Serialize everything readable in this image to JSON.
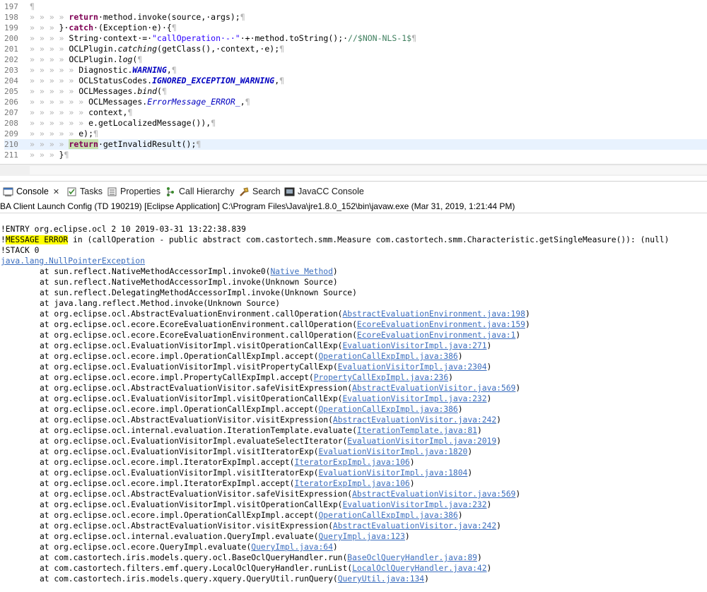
{
  "editor": {
    "lines": [
      {
        "n": "197",
        "segs": [
          {
            "t": "¶",
            "c": "ws"
          }
        ]
      },
      {
        "n": "198",
        "segs": [
          {
            "t": "» » » » ",
            "c": "ws"
          },
          {
            "t": "return",
            "c": "kw"
          },
          {
            "t": "·method.invoke(source,·args);",
            "c": ""
          },
          {
            "t": "¶",
            "c": "ws"
          }
        ]
      },
      {
        "n": "199",
        "segs": [
          {
            "t": "» » » ",
            "c": "ws"
          },
          {
            "t": "}·",
            "c": ""
          },
          {
            "t": "catch",
            "c": "kw"
          },
          {
            "t": "·(Exception·e)·{",
            "c": ""
          },
          {
            "t": "¶",
            "c": "ws"
          }
        ]
      },
      {
        "n": "200",
        "segs": [
          {
            "t": "» » » » ",
            "c": "ws"
          },
          {
            "t": "String·context·=·",
            "c": ""
          },
          {
            "t": "\"callOperation·-·\"",
            "c": "str"
          },
          {
            "t": "·+·method.toString();·",
            "c": ""
          },
          {
            "t": "//$NON-NLS-1$",
            "c": "cmt"
          },
          {
            "t": "¶",
            "c": "ws"
          }
        ]
      },
      {
        "n": "201",
        "segs": [
          {
            "t": "» » » » ",
            "c": "ws"
          },
          {
            "t": "OCLPlugin.",
            "c": ""
          },
          {
            "t": "catching",
            "c": "sm"
          },
          {
            "t": "(getClass(),·context,·e);",
            "c": ""
          },
          {
            "t": "¶",
            "c": "ws"
          }
        ]
      },
      {
        "n": "202",
        "segs": [
          {
            "t": "» » » » ",
            "c": "ws"
          },
          {
            "t": "OCLPlugin.",
            "c": ""
          },
          {
            "t": "log",
            "c": "sm"
          },
          {
            "t": "(",
            "c": ""
          },
          {
            "t": "¶",
            "c": "ws"
          }
        ]
      },
      {
        "n": "203",
        "segs": [
          {
            "t": "» » » » » ",
            "c": "ws"
          },
          {
            "t": "Diagnostic.",
            "c": ""
          },
          {
            "t": "WARNING",
            "c": "cst"
          },
          {
            "t": ",",
            "c": ""
          },
          {
            "t": "¶",
            "c": "ws"
          }
        ]
      },
      {
        "n": "204",
        "segs": [
          {
            "t": "» » » » » ",
            "c": "ws"
          },
          {
            "t": "OCLStatusCodes.",
            "c": ""
          },
          {
            "t": "IGNORED_EXCEPTION_WARNING",
            "c": "cst"
          },
          {
            "t": ",",
            "c": ""
          },
          {
            "t": "¶",
            "c": "ws"
          }
        ]
      },
      {
        "n": "205",
        "segs": [
          {
            "t": "» » » » » ",
            "c": "ws"
          },
          {
            "t": "OCLMessages.",
            "c": ""
          },
          {
            "t": "bind",
            "c": "sm"
          },
          {
            "t": "(",
            "c": ""
          },
          {
            "t": "¶",
            "c": "ws"
          }
        ]
      },
      {
        "n": "206",
        "segs": [
          {
            "t": "» » » » » » ",
            "c": "ws"
          },
          {
            "t": "OCLMessages.",
            "c": ""
          },
          {
            "t": "ErrorMessage_ERROR_",
            "c": "itf"
          },
          {
            "t": ",",
            "c": ""
          },
          {
            "t": "¶",
            "c": "ws"
          }
        ]
      },
      {
        "n": "207",
        "segs": [
          {
            "t": "» » » » » » ",
            "c": "ws"
          },
          {
            "t": "context,",
            "c": ""
          },
          {
            "t": "¶",
            "c": "ws"
          }
        ]
      },
      {
        "n": "208",
        "segs": [
          {
            "t": "» » » » » » ",
            "c": "ws"
          },
          {
            "t": "e.getLocalizedMessage()),",
            "c": ""
          },
          {
            "t": "¶",
            "c": "ws"
          }
        ]
      },
      {
        "n": "209",
        "segs": [
          {
            "t": "» » » » » ",
            "c": "ws"
          },
          {
            "t": "e);",
            "c": ""
          },
          {
            "t": "¶",
            "c": "ws"
          }
        ]
      },
      {
        "n": "210",
        "segs": [
          {
            "t": "» » » » ",
            "c": "ws"
          },
          {
            "t": "return",
            "c": "kw hl-ret"
          },
          {
            "t": "·getInvalidResult();",
            "c": ""
          },
          {
            "t": "¶",
            "c": "ws"
          }
        ],
        "current": true
      },
      {
        "n": "211",
        "segs": [
          {
            "t": "» » » ",
            "c": "ws"
          },
          {
            "t": "}",
            "c": ""
          },
          {
            "t": "¶",
            "c": "ws"
          }
        ]
      }
    ]
  },
  "tabs": [
    {
      "label": "Console",
      "icon": "console-icon",
      "active": true,
      "closable": true
    },
    {
      "label": "Tasks",
      "icon": "tasks-icon"
    },
    {
      "label": "Properties",
      "icon": "properties-icon"
    },
    {
      "label": "Call Hierarchy",
      "icon": "call-hierarchy-icon"
    },
    {
      "label": "Search",
      "icon": "search-icon"
    },
    {
      "label": "JavaCC Console",
      "icon": "javacc-console-icon"
    }
  ],
  "launch_description": "BA Client Launch Config (TD 190219) [Eclipse Application] C:\\Program Files\\Java\\jre1.8.0_152\\bin\\javaw.exe (Mar 31, 2019, 1:21:44 PM)",
  "console": {
    "entry": "!ENTRY org.eclipse.ocl 2 10 2019-03-31 13:22:38.839",
    "message_prefix": "!",
    "message_highlight": "MESSAGE ERROR",
    "message_rest": " in (callOperation - public abstract com.castortech.smm.Measure com.castortech.smm.Characteristic.getSingleMeasure()): (null)",
    "stack": "!STACK 0",
    "exception": "java.lang.NullPointerException",
    "frames": [
      {
        "pre": "at sun.reflect.NativeMethodAccessorImpl.invoke0(",
        "link": "Native Method",
        "post": ")"
      },
      {
        "pre": "at sun.reflect.NativeMethodAccessorImpl.invoke(Unknown Source)",
        "link": "",
        "post": ""
      },
      {
        "pre": "at sun.reflect.DelegatingMethodAccessorImpl.invoke(Unknown Source)",
        "link": "",
        "post": ""
      },
      {
        "pre": "at java.lang.reflect.Method.invoke(Unknown Source)",
        "link": "",
        "post": ""
      },
      {
        "pre": "at org.eclipse.ocl.AbstractEvaluationEnvironment.callOperation(",
        "link": "AbstractEvaluationEnvironment.java:198",
        "post": ")"
      },
      {
        "pre": "at org.eclipse.ocl.ecore.EcoreEvaluationEnvironment.callOperation(",
        "link": "EcoreEvaluationEnvironment.java:159",
        "post": ")"
      },
      {
        "pre": "at org.eclipse.ocl.ecore.EcoreEvaluationEnvironment.callOperation(",
        "link": "EcoreEvaluationEnvironment.java:1",
        "post": ")"
      },
      {
        "pre": "at org.eclipse.ocl.EvaluationVisitorImpl.visitOperationCallExp(",
        "link": "EvaluationVisitorImpl.java:271",
        "post": ")"
      },
      {
        "pre": "at org.eclipse.ocl.ecore.impl.OperationCallExpImpl.accept(",
        "link": "OperationCallExpImpl.java:386",
        "post": ")"
      },
      {
        "pre": "at org.eclipse.ocl.EvaluationVisitorImpl.visitPropertyCallExp(",
        "link": "EvaluationVisitorImpl.java:2304",
        "post": ")"
      },
      {
        "pre": "at org.eclipse.ocl.ecore.impl.PropertyCallExpImpl.accept(",
        "link": "PropertyCallExpImpl.java:236",
        "post": ")"
      },
      {
        "pre": "at org.eclipse.ocl.AbstractEvaluationVisitor.safeVisitExpression(",
        "link": "AbstractEvaluationVisitor.java:569",
        "post": ")"
      },
      {
        "pre": "at org.eclipse.ocl.EvaluationVisitorImpl.visitOperationCallExp(",
        "link": "EvaluationVisitorImpl.java:232",
        "post": ")"
      },
      {
        "pre": "at org.eclipse.ocl.ecore.impl.OperationCallExpImpl.accept(",
        "link": "OperationCallExpImpl.java:386",
        "post": ")"
      },
      {
        "pre": "at org.eclipse.ocl.AbstractEvaluationVisitor.visitExpression(",
        "link": "AbstractEvaluationVisitor.java:242",
        "post": ")"
      },
      {
        "pre": "at org.eclipse.ocl.internal.evaluation.IterationTemplate.evaluate(",
        "link": "IterationTemplate.java:81",
        "post": ")"
      },
      {
        "pre": "at org.eclipse.ocl.EvaluationVisitorImpl.evaluateSelectIterator(",
        "link": "EvaluationVisitorImpl.java:2019",
        "post": ")"
      },
      {
        "pre": "at org.eclipse.ocl.EvaluationVisitorImpl.visitIteratorExp(",
        "link": "EvaluationVisitorImpl.java:1820",
        "post": ")"
      },
      {
        "pre": "at org.eclipse.ocl.ecore.impl.IteratorExpImpl.accept(",
        "link": "IteratorExpImpl.java:106",
        "post": ")"
      },
      {
        "pre": "at org.eclipse.ocl.EvaluationVisitorImpl.visitIteratorExp(",
        "link": "EvaluationVisitorImpl.java:1804",
        "post": ")"
      },
      {
        "pre": "at org.eclipse.ocl.ecore.impl.IteratorExpImpl.accept(",
        "link": "IteratorExpImpl.java:106",
        "post": ")"
      },
      {
        "pre": "at org.eclipse.ocl.AbstractEvaluationVisitor.safeVisitExpression(",
        "link": "AbstractEvaluationVisitor.java:569",
        "post": ")"
      },
      {
        "pre": "at org.eclipse.ocl.EvaluationVisitorImpl.visitOperationCallExp(",
        "link": "EvaluationVisitorImpl.java:232",
        "post": ")"
      },
      {
        "pre": "at org.eclipse.ocl.ecore.impl.OperationCallExpImpl.accept(",
        "link": "OperationCallExpImpl.java:386",
        "post": ")"
      },
      {
        "pre": "at org.eclipse.ocl.AbstractEvaluationVisitor.visitExpression(",
        "link": "AbstractEvaluationVisitor.java:242",
        "post": ")"
      },
      {
        "pre": "at org.eclipse.ocl.internal.evaluation.QueryImpl.evaluate(",
        "link": "QueryImpl.java:123",
        "post": ")"
      },
      {
        "pre": "at org.eclipse.ocl.ecore.QueryImpl.evaluate(",
        "link": "QueryImpl.java:64",
        "post": ")"
      },
      {
        "pre": "at com.castortech.iris.models.query.ocl.BaseOclQueryHandler.run(",
        "link": "BaseOclQueryHandler.java:89",
        "post": ")"
      },
      {
        "pre": "at com.castortech.filters.emf.query.LocalOclQueryHandler.runList(",
        "link": "LocalOclQueryHandler.java:42",
        "post": ")"
      },
      {
        "pre": "at com.castortech.iris.models.query.xquery.QueryUtil.runQuery(",
        "link": "QueryUtil.java:134",
        "post": ")"
      }
    ]
  },
  "colors": {
    "keyword": "#7f0055",
    "string": "#2a00ff",
    "constant": "#0000c0",
    "comment": "#3f7f5f",
    "link": "#3c6ebe",
    "highlight": "#ffff00",
    "current_line": "#e8f2fe"
  }
}
